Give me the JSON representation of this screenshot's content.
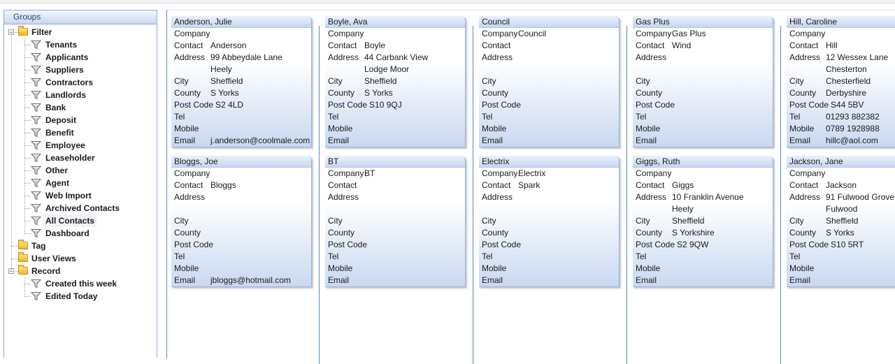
{
  "groups": {
    "header": "Groups",
    "nodes": [
      {
        "label": "Filter",
        "kind": "folder",
        "level": 0,
        "expander": "−"
      },
      {
        "label": "Tenants",
        "kind": "filter",
        "level": 1
      },
      {
        "label": "Applicants",
        "kind": "filter",
        "level": 1
      },
      {
        "label": "Suppliers",
        "kind": "filter",
        "level": 1
      },
      {
        "label": "Contractors",
        "kind": "filter",
        "level": 1
      },
      {
        "label": "Landlords",
        "kind": "filter",
        "level": 1
      },
      {
        "label": "Bank",
        "kind": "filter",
        "level": 1
      },
      {
        "label": "Deposit",
        "kind": "filter",
        "level": 1
      },
      {
        "label": "Benefit",
        "kind": "filter",
        "level": 1
      },
      {
        "label": "Employee",
        "kind": "filter",
        "level": 1
      },
      {
        "label": "Leaseholder",
        "kind": "filter",
        "level": 1
      },
      {
        "label": "Other",
        "kind": "filter",
        "level": 1
      },
      {
        "label": "Agent",
        "kind": "filter",
        "level": 1
      },
      {
        "label": "Web Import",
        "kind": "filter",
        "level": 1
      },
      {
        "label": "Archived Contacts",
        "kind": "filter",
        "level": 1
      },
      {
        "label": "All Contacts",
        "kind": "filter",
        "level": 1,
        "selected": true
      },
      {
        "label": "Dashboard",
        "kind": "filter",
        "level": 1
      },
      {
        "label": "Tag",
        "kind": "folder",
        "level": 0
      },
      {
        "label": "User Views",
        "kind": "folder",
        "level": 0
      },
      {
        "label": "Record",
        "kind": "folder",
        "level": 0,
        "expander": "−"
      },
      {
        "label": "Created this week",
        "kind": "filter",
        "level": 1
      },
      {
        "label": "Edited Today",
        "kind": "filter",
        "level": 1
      }
    ]
  },
  "field_labels": {
    "company": "Company",
    "contact": "Contact",
    "address": "Address",
    "city": "City",
    "county": "County",
    "postcode": "Post Code",
    "tel": "Tel",
    "mobile": "Mobile",
    "email": "Email"
  },
  "cards": [
    {
      "title": "Anderson, Julie",
      "company": "",
      "contact": "Anderson",
      "address1": "99 Abbeydale Lane",
      "address2": "Heely",
      "city": "Sheffield",
      "county": "S Yorks",
      "postcode": "S2 4LD",
      "tel": "",
      "mobile": "",
      "email": "j.anderson@coolmale.com"
    },
    {
      "title": "Bloggs, Joe",
      "company": "",
      "contact": "Bloggs",
      "address1": "",
      "address2": "",
      "city": "",
      "county": "",
      "postcode": "",
      "tel": "",
      "mobile": "",
      "email": "jbloggs@hotmail.com"
    },
    {
      "title": "Boyle, Ava",
      "company": "",
      "contact": "Boyle",
      "address1": "44 Carbank View",
      "address2": "Lodge Moor",
      "city": "Sheffield",
      "county": "S Yorks",
      "postcode": "S10 9QJ",
      "tel": "",
      "mobile": "",
      "email": ""
    },
    {
      "title": "BT",
      "company": "BT",
      "contact": "",
      "address1": "",
      "address2": "",
      "city": "",
      "county": "",
      "postcode": "",
      "tel": "",
      "mobile": "",
      "email": ""
    },
    {
      "title": "Council",
      "company": "Council",
      "contact": "",
      "address1": "",
      "address2": "",
      "city": "",
      "county": "",
      "postcode": "",
      "tel": "",
      "mobile": "",
      "email": ""
    },
    {
      "title": "Electrix",
      "company": "Electrix",
      "contact": "Spark",
      "address1": "",
      "address2": "",
      "city": "",
      "county": "",
      "postcode": "",
      "tel": "",
      "mobile": "",
      "email": ""
    },
    {
      "title": "Gas Plus",
      "company": "Gas Plus",
      "contact": "Wind",
      "address1": "",
      "address2": "",
      "city": "",
      "county": "",
      "postcode": "",
      "tel": "",
      "mobile": "",
      "email": ""
    },
    {
      "title": "Giggs, Ruth",
      "company": "",
      "contact": "Giggs",
      "address1": "10 Franklin Avenue",
      "address2": "Heely",
      "city": "Sheffield",
      "county": "S Yorkshire",
      "postcode": "S2 9QW",
      "tel": "",
      "mobile": "",
      "email": ""
    },
    {
      "title": "Hill, Caroline",
      "company": "",
      "contact": "Hill",
      "address1": "12 Wessex Lane",
      "address2": "Chesterton",
      "city": "Chesterfield",
      "county": "Derbyshire",
      "postcode": "S44 5BV",
      "tel": "01293 882382",
      "mobile": "0789 1928988",
      "email": "hillc@aol.com"
    },
    {
      "title": "Jackson, Jane",
      "company": "",
      "contact": "Jackson",
      "address1": "91 Fulwood Grove",
      "address2": "Fulwood",
      "city": "Sheffield",
      "county": "S Yorks",
      "postcode": "S10 5RT",
      "tel": "",
      "mobile": "",
      "email": ""
    }
  ]
}
